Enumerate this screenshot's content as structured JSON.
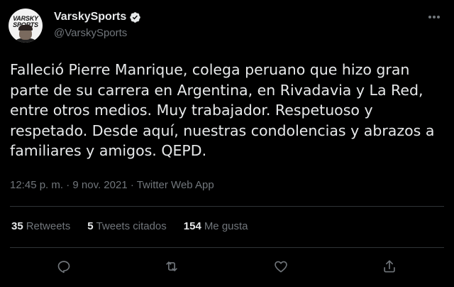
{
  "author": {
    "display_name": "VarskySports",
    "handle": "@VarskySports",
    "avatar_logo_text": "VARSKY SPORTS",
    "verified": true
  },
  "tweet": {
    "text": "Falleció Pierre Manrique, colega peruano que hizo gran parte de su carrera en Argentina, en Rivadavia y La Red, entre otros medios. Muy trabajador. Respetuoso y respetado. Desde aquí, nuestras condolencias y abrazos a familiares y amigos. QEPD.",
    "meta": "12:45 p. m. · 9 nov. 2021 · Twitter Web App"
  },
  "stats": {
    "retweets_count": "35",
    "retweets_label": "Retweets",
    "quotes_count": "5",
    "quotes_label": "Tweets citados",
    "likes_count": "154",
    "likes_label": "Me gusta"
  },
  "icons": {
    "verified": "verified-badge-icon",
    "more": "more-icon",
    "reply": "reply-icon",
    "retweet": "retweet-icon",
    "like": "heart-icon",
    "share": "share-icon"
  },
  "colors": {
    "background": "#000000",
    "text": "#e7e9ea",
    "secondary": "#71767b",
    "divider": "#2f3336",
    "verified": "#1d9bf0"
  }
}
